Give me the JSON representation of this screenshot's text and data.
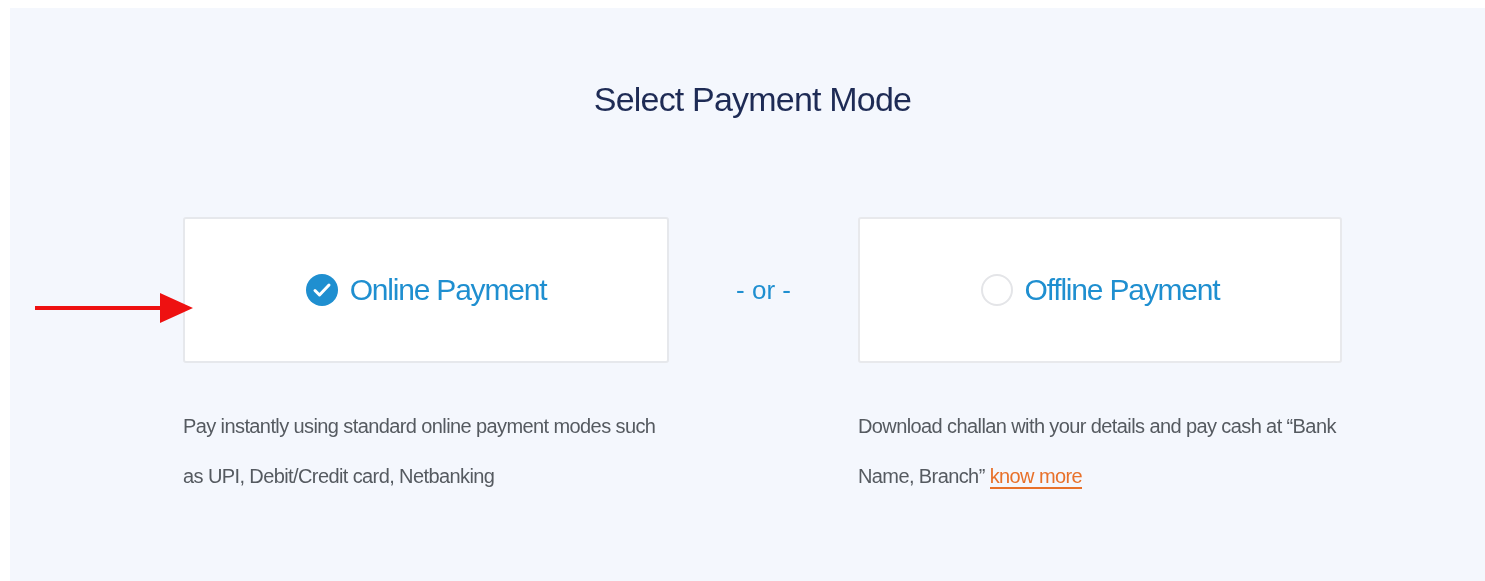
{
  "title": "Select Payment Mode",
  "options": [
    {
      "label": "Online Payment",
      "selected": true,
      "description": "Pay instantly using standard online payment modes such as UPI, Debit/Credit card, Netbanking"
    },
    {
      "label": "Offline Payment",
      "selected": false,
      "description": "Download challan with your details and pay cash at “Bank Name, Branch”",
      "link": "know more"
    }
  ],
  "separator": "- or -"
}
